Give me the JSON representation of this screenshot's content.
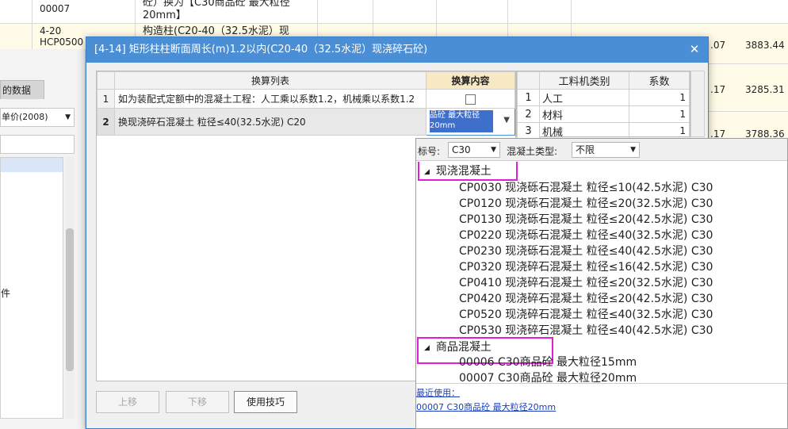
{
  "background": {
    "rows": [
      {
        "code": "00007",
        "desc": "砼）换为【C30商品砼 最大粒径20mm】"
      },
      {
        "code": "4-20\nHCP0500",
        "desc": "构造柱(C20-40（32.5水泥）现"
      }
    ],
    "left_tab": "的数据",
    "left_select": "单价(2008)",
    "left_label": "件",
    "right_nums": [
      ".07",
      "3883.44",
      ".17",
      "3285.31",
      ".17",
      "3788.36"
    ]
  },
  "dialog": {
    "title": "[4-14] 矩形柱柱断面周长(m)1.2以内(C20-40（32.5水泥）现浇碎石砼)",
    "close": "✕",
    "table": {
      "col_list": "换算列表",
      "col_content": "换算内容",
      "rows": [
        {
          "num": "1",
          "text": "如为装配式定额中的混凝土工程：人工乘以系数1.2，机械乘以系数1.2"
        },
        {
          "num": "2",
          "text": "换现浇碎石混凝土 粒径≤40(32.5水泥) C20",
          "value": "品砼 最大粒径20mm"
        }
      ]
    },
    "buttons": {
      "up": "上移",
      "down": "下移",
      "tips": "使用技巧"
    },
    "right_table": {
      "col_type": "工料机类别",
      "col_coef": "系数",
      "rows": [
        {
          "num": "1",
          "type": "人工",
          "coef": "1"
        },
        {
          "num": "2",
          "type": "材料",
          "coef": "1"
        },
        {
          "num": "3",
          "type": "机械",
          "coef": "1"
        }
      ]
    }
  },
  "popup": {
    "grade_label": "标号:",
    "grade_value": "C30",
    "type_label": "混凝土类型:",
    "type_value": "不限",
    "groups": [
      {
        "name": "现浇混凝土",
        "items": [
          "CP0030  现浇砾石混凝土 粒径≤10(42.5水泥) C30",
          "CP0120  现浇砾石混凝土 粒径≤20(32.5水泥) C30",
          "CP0130  现浇砾石混凝土 粒径≤20(42.5水泥) C30",
          "CP0220  现浇砾石混凝土 粒径≤40(32.5水泥) C30",
          "CP0230  现浇砾石混凝土 粒径≤40(42.5水泥) C30",
          "CP0320  现浇碎石混凝土 粒径≤16(42.5水泥) C30",
          "CP0410  现浇碎石混凝土 粒径≤20(32.5水泥) C30",
          "CP0420  现浇碎石混凝土 粒径≤20(42.5水泥) C30",
          "CP0520  现浇碎石混凝土 粒径≤40(32.5水泥) C30",
          "CP0530  现浇碎石混凝土 粒径≤40(42.5水泥) C30"
        ]
      },
      {
        "name": "商品混凝土",
        "items": [
          "00006  C30商品砼 最大粒径15mm",
          "00007  C30商品砼 最大粒径20mm"
        ]
      }
    ],
    "recent_label": "最近使用：",
    "recent_item": "00007 C30商品砼 最大粒径20mm"
  },
  "colors": {
    "title_bar": "#4a8fd6",
    "highlight": "#e01ed6",
    "link": "#1a3fbf",
    "selection": "#3f6fcc"
  }
}
